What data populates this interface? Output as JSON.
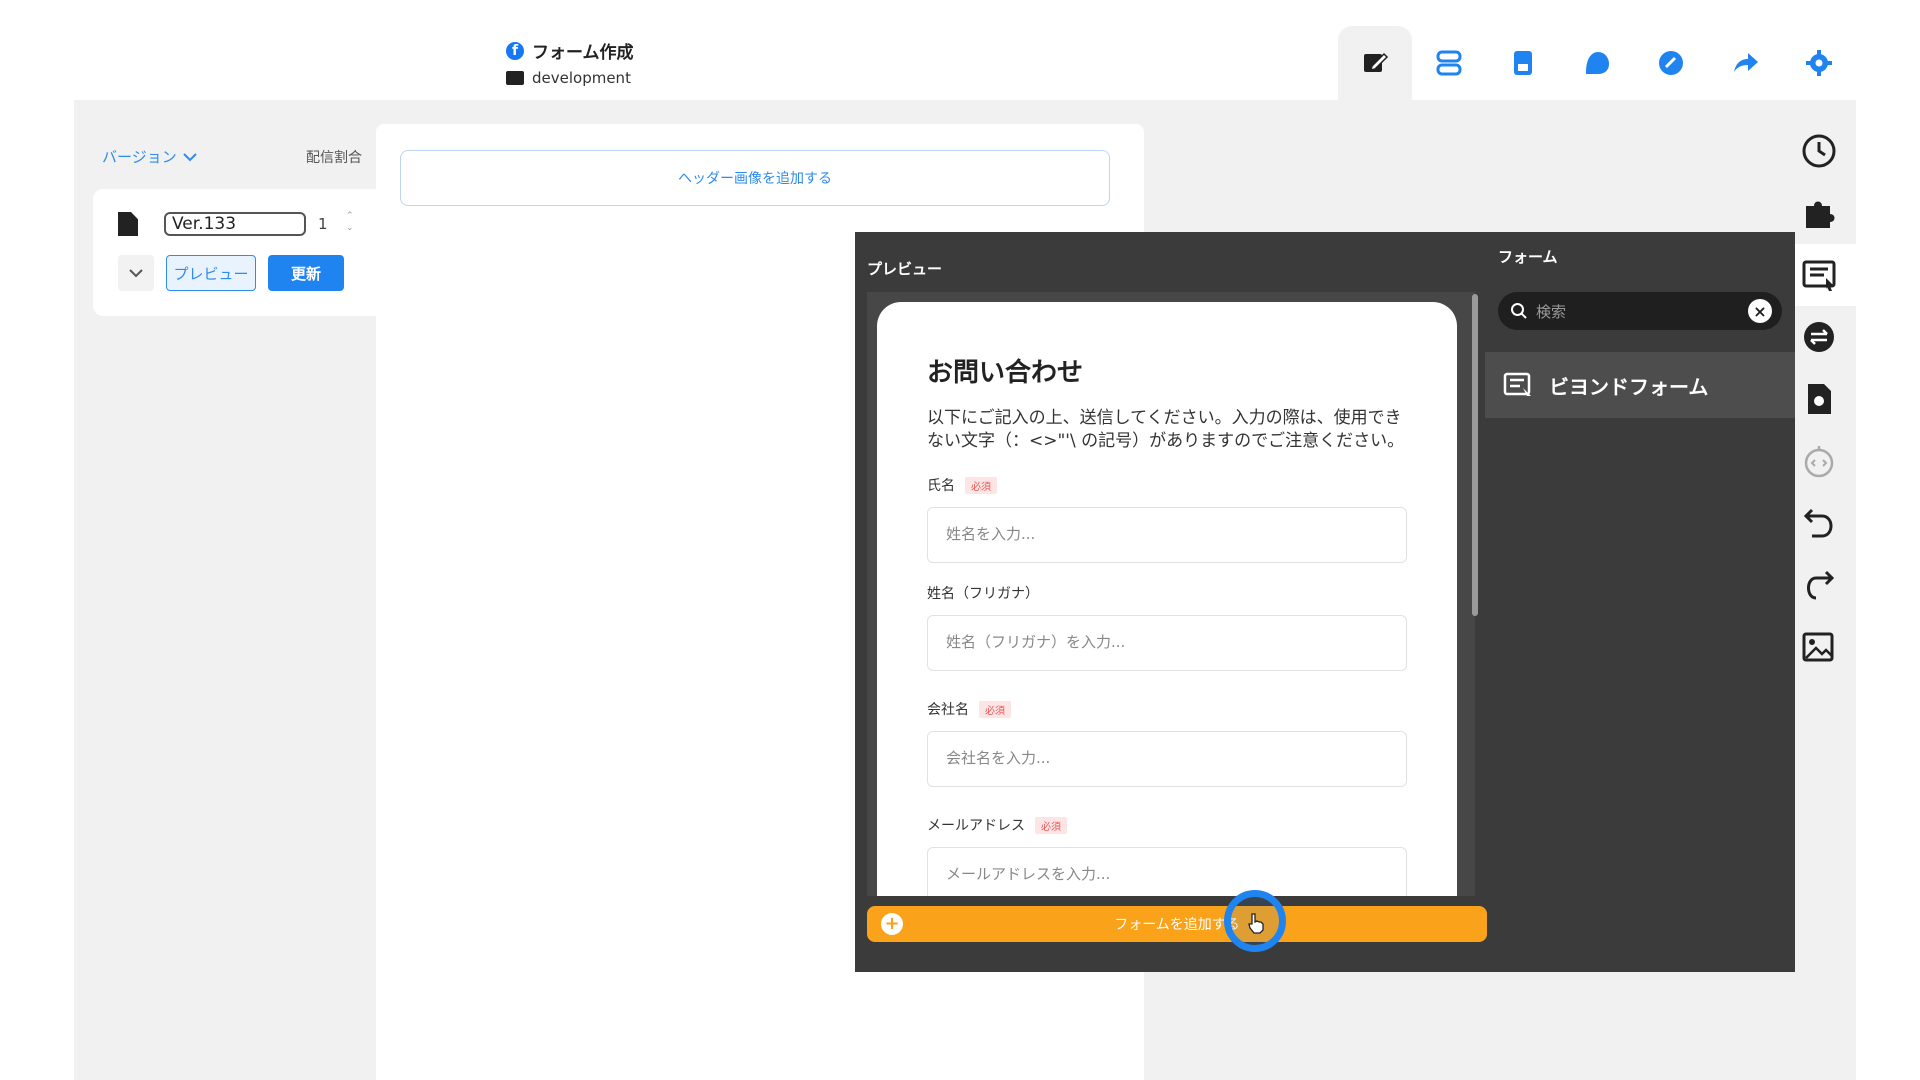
{
  "header": {
    "title": "フォーム作成",
    "folder": "development"
  },
  "toolbar": {
    "icons": [
      "edit-icon",
      "layout-icon",
      "page-icon",
      "chat-icon",
      "link-icon",
      "share-icon",
      "gear-icon"
    ]
  },
  "left": {
    "version_label": "バージョン",
    "ratio_label": "配信割合",
    "version_value": "Ver.133",
    "ratio_value": "1",
    "preview_label": "プレビュー",
    "update_label": "更新"
  },
  "canvas": {
    "add_header_label": "ヘッダー画像を追加する"
  },
  "modal": {
    "preview_title": "プレビュー",
    "form_panel_title": "フォーム",
    "search_placeholder": "検索",
    "component_label": "ビヨンドフォーム",
    "add_form_label": "フォームを追加する"
  },
  "form": {
    "title": "お問い合わせ",
    "description": "以下にご記入の上、送信してください。入力の際は、使用できない文字（：<>\"'\\ の記号）がありますのでご注意ください。",
    "required_badge": "必須",
    "fields": [
      {
        "label": "氏名",
        "placeholder": "姓名を入力...",
        "required": true
      },
      {
        "label": "姓名（フリガナ）",
        "placeholder": "姓名（フリガナ）を入力...",
        "required": false
      },
      {
        "label": "会社名",
        "placeholder": "会社名を入力...",
        "required": true
      },
      {
        "label": "メールアドレス",
        "placeholder": "メールアドレスを入力...",
        "required": true
      }
    ]
  },
  "rail": {
    "icons": [
      "history-icon",
      "puzzle-icon",
      "form-icon",
      "exchange-icon",
      "file-settings-icon",
      "timer-code-icon",
      "undo-icon",
      "redo-icon",
      "image-upload-icon"
    ],
    "active": "form-icon"
  },
  "colors": {
    "accent": "#1f84ef",
    "orange": "#f9a21a",
    "modal_bg": "#3b3b3b"
  }
}
